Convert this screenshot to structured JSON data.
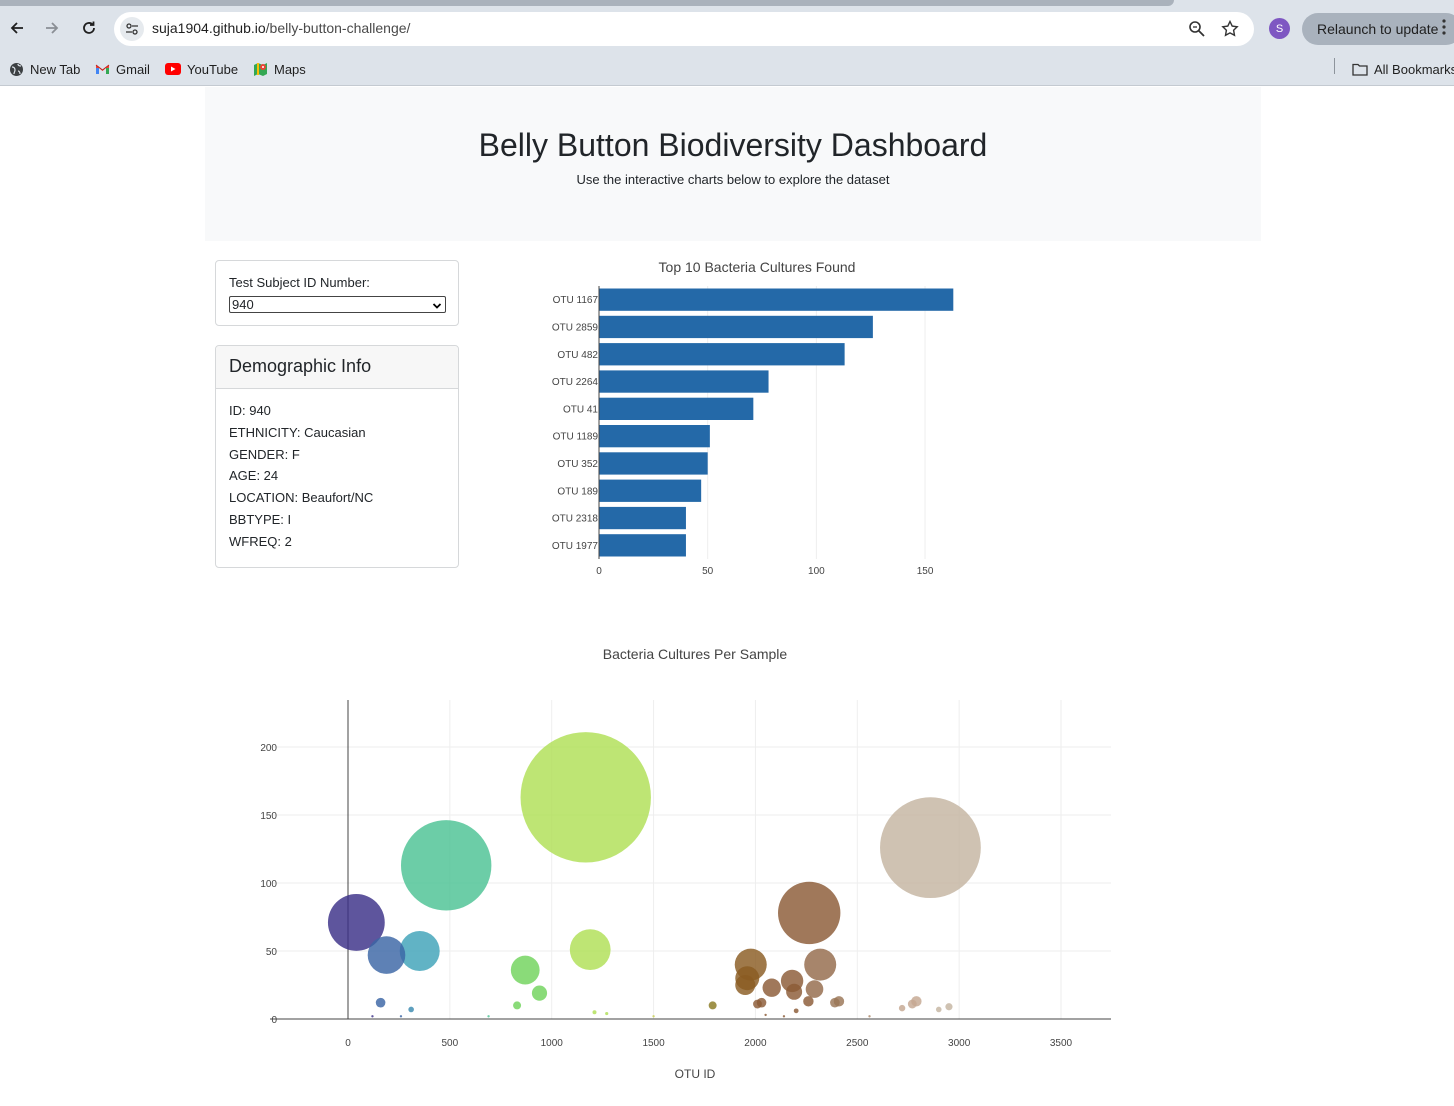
{
  "browser": {
    "url_host": "suja1904.github.io",
    "url_path": "/belly-button-challenge/",
    "profile_initial": "S",
    "relaunch_label": "Relaunch to update",
    "bookmarks": [
      {
        "label": "New Tab",
        "icon": "globe-icon"
      },
      {
        "label": "Gmail",
        "icon": "gmail-icon"
      },
      {
        "label": "YouTube",
        "icon": "youtube-icon"
      },
      {
        "label": "Maps",
        "icon": "maps-icon"
      }
    ],
    "all_bookmarks_label": "All Bookmarks"
  },
  "header": {
    "title": "Belly Button Biodiversity Dashboard",
    "subtitle": "Use the interactive charts below to explore the dataset"
  },
  "selector": {
    "label": "Test Subject ID Number:",
    "selected": "940"
  },
  "demographics": {
    "title": "Demographic Info",
    "lines": [
      "ID: 940",
      "ETHNICITY: Caucasian",
      "GENDER: F",
      "AGE: 24",
      "LOCATION: Beaufort/NC",
      "BBTYPE: I",
      "WFREQ: 2"
    ]
  },
  "chart_data": [
    {
      "type": "bar",
      "orientation": "horizontal",
      "title": "Top 10 Bacteria Cultures Found",
      "xlabel": "",
      "ylabel": "",
      "categories": [
        "OTU 1167",
        "OTU 2859",
        "OTU 482",
        "OTU 2264",
        "OTU 41",
        "OTU 1189",
        "OTU 352",
        "OTU 189",
        "OTU 2318",
        "OTU 1977"
      ],
      "values": [
        163,
        126,
        113,
        78,
        71,
        51,
        50,
        47,
        40,
        40
      ],
      "xlim": [
        0,
        167
      ],
      "xticks": [
        0,
        50,
        100,
        150
      ],
      "color": "#2469a8",
      "grid": true
    },
    {
      "type": "scatter",
      "style": "bubble",
      "title": "Bacteria Cultures Per Sample",
      "xlabel": "OTU ID",
      "ylabel": "",
      "xlim": [
        -340,
        3750
      ],
      "ylim": [
        -10,
        225
      ],
      "xticks": [
        0,
        500,
        1000,
        1500,
        2000,
        2500,
        3000,
        3500
      ],
      "yticks": [
        0,
        50,
        100,
        150,
        200
      ],
      "grid": true,
      "colorscale": "Earth",
      "points": [
        {
          "x": 41,
          "y": 71,
          "color": "#3a2f88"
        },
        {
          "x": 189,
          "y": 47,
          "color": "#3b65a5"
        },
        {
          "x": 352,
          "y": 50,
          "color": "#3ea2b8"
        },
        {
          "x": 482,
          "y": 113,
          "color": "#4cc294"
        },
        {
          "x": 1167,
          "y": 163,
          "color": "#b0df55"
        },
        {
          "x": 1189,
          "y": 51,
          "color": "#b0df55"
        },
        {
          "x": 870,
          "y": 36,
          "color": "#70d35c"
        },
        {
          "x": 940,
          "y": 19,
          "color": "#70d35c"
        },
        {
          "x": 2264,
          "y": 78,
          "color": "#8b5a36"
        },
        {
          "x": 2859,
          "y": 126,
          "color": "#c4b4a1"
        },
        {
          "x": 1977,
          "y": 40,
          "color": "#8a5c22"
        },
        {
          "x": 1960,
          "y": 30,
          "color": "#8a5c22"
        },
        {
          "x": 1950,
          "y": 25,
          "color": "#8a5c22"
        },
        {
          "x": 2318,
          "y": 40,
          "color": "#946a4a"
        },
        {
          "x": 2180,
          "y": 28,
          "color": "#8b5a36"
        },
        {
          "x": 2080,
          "y": 23,
          "color": "#8b5a36"
        },
        {
          "x": 2190,
          "y": 20,
          "color": "#8b5a36"
        },
        {
          "x": 2290,
          "y": 22,
          "color": "#946a4a"
        },
        {
          "x": 2260,
          "y": 13,
          "color": "#8b5a36"
        },
        {
          "x": 160,
          "y": 12,
          "color": "#3b65a5"
        },
        {
          "x": 310,
          "y": 7,
          "color": "#3b8ab0"
        },
        {
          "x": 830,
          "y": 10,
          "color": "#70d35c"
        },
        {
          "x": 1790,
          "y": 10,
          "color": "#8a7a22"
        },
        {
          "x": 2030,
          "y": 12,
          "color": "#8b5a36"
        },
        {
          "x": 2010,
          "y": 11,
          "color": "#8b5a36"
        },
        {
          "x": 2410,
          "y": 13,
          "color": "#9a7556"
        },
        {
          "x": 2390,
          "y": 12,
          "color": "#9a7556"
        },
        {
          "x": 2770,
          "y": 11,
          "color": "#c4a791"
        },
        {
          "x": 2790,
          "y": 13,
          "color": "#c4a791"
        },
        {
          "x": 2720,
          "y": 8,
          "color": "#c4a791"
        },
        {
          "x": 2950,
          "y": 9,
          "color": "#c4b4a1"
        },
        {
          "x": 2900,
          "y": 7,
          "color": "#c4b4a1"
        },
        {
          "x": 2200,
          "y": 6,
          "color": "#8b5a36"
        },
        {
          "x": 1210,
          "y": 5,
          "color": "#b0df55"
        },
        {
          "x": 1270,
          "y": 4,
          "color": "#b0df55"
        },
        {
          "x": 120,
          "y": 2,
          "color": "#3a2f88"
        },
        {
          "x": 260,
          "y": 2,
          "color": "#3b65a5"
        },
        {
          "x": 690,
          "y": 2,
          "color": "#4cc294"
        },
        {
          "x": 2560,
          "y": 2,
          "color": "#a98668"
        },
        {
          "x": 2140,
          "y": 2,
          "color": "#8b5a36"
        },
        {
          "x": 2050,
          "y": 3,
          "color": "#8b5a36"
        },
        {
          "x": 1500,
          "y": 2,
          "color": "#c9d050"
        }
      ]
    }
  ]
}
